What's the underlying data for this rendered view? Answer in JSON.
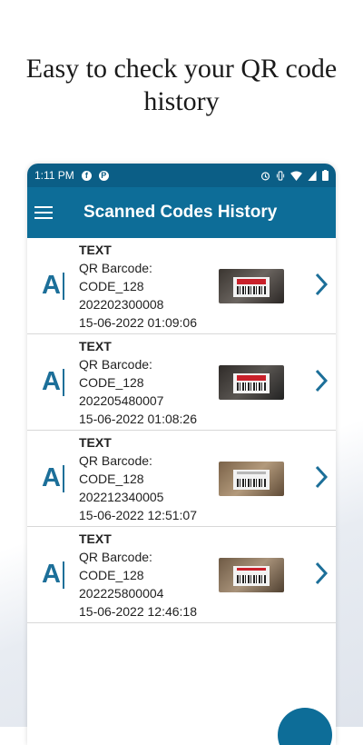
{
  "headline": "Easy to check your QR code history",
  "status_bar": {
    "time": "1:11 PM"
  },
  "appbar": {
    "title": "Scanned Codes History"
  },
  "records": [
    {
      "kind": "TEXT",
      "format_label": "QR Barcode:",
      "format": "CODE_128",
      "value": "202202300008",
      "datetime": "15-06-2022 01:09:06"
    },
    {
      "kind": "TEXT",
      "format_label": "QR Barcode:",
      "format": "CODE_128",
      "value": "202205480007",
      "datetime": "15-06-2022 01:08:26"
    },
    {
      "kind": "TEXT",
      "format_label": "QR Barcode:",
      "format": "CODE_128",
      "value": "202212340005",
      "datetime": "15-06-2022 12:51:07"
    },
    {
      "kind": "TEXT",
      "format_label": "QR Barcode:",
      "format": "CODE_128",
      "value": "202225800004",
      "datetime": "15-06-2022 12:46:18"
    }
  ],
  "icons": {
    "menu": "hamburger-menu-icon",
    "row_type": "text-type-icon",
    "row_action": "chevron-right-icon"
  },
  "colors": {
    "status_bar": "#0b5e86",
    "appbar": "#0d6d98",
    "accent": "#1c6f99"
  }
}
